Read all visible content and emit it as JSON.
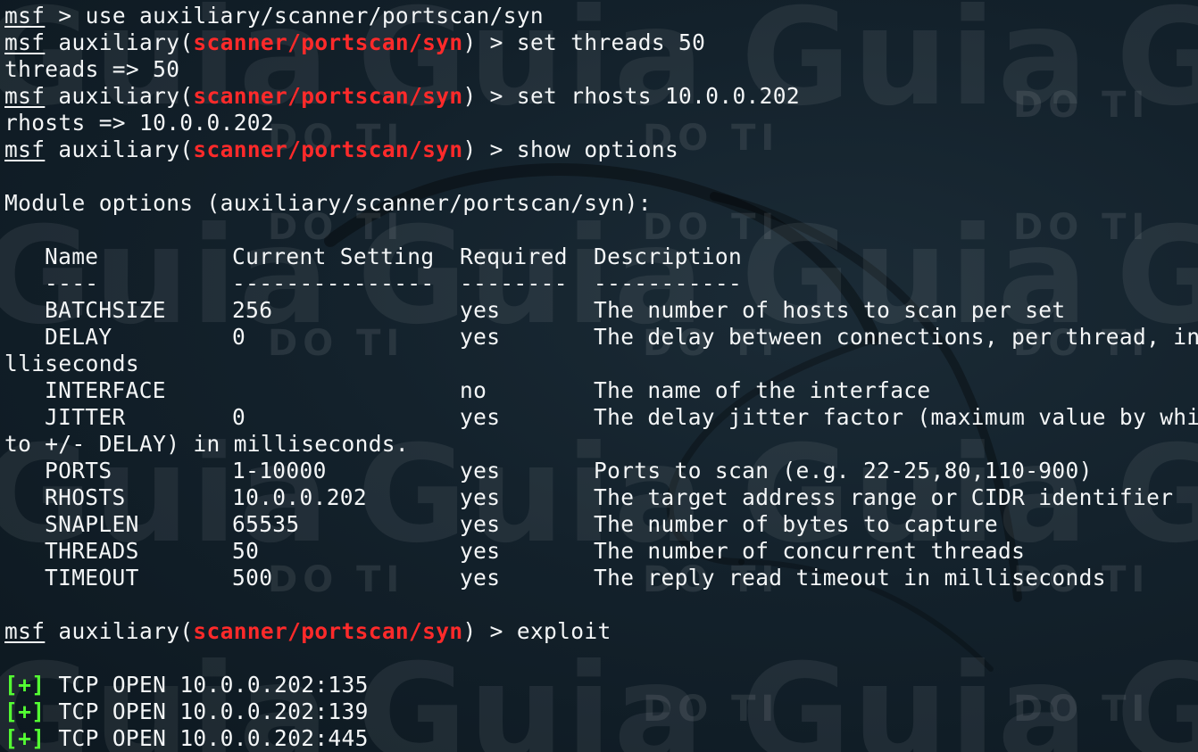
{
  "watermark": {
    "brand_word": "Guia",
    "brand_sub": "DO TI"
  },
  "prompt": {
    "base": "msf",
    "module_prefix": " auxiliary(",
    "module": "scanner/portscan/syn",
    "module_suffix": ") > "
  },
  "session": {
    "cmd_use": "msf > use auxiliary/scanner/portscan/syn",
    "cmd_set_threads": "set threads 50",
    "out_threads": "threads => 50",
    "cmd_set_rhosts": "set rhosts 10.0.0.202",
    "out_rhosts": "rhosts => 10.0.0.202",
    "cmd_show": "show options",
    "module_options_header": "Module options (auxiliary/scanner/portscan/syn):",
    "cmd_exploit": "exploit"
  },
  "options_table": {
    "headers": [
      "Name",
      "Current Setting",
      "Required",
      "Description"
    ],
    "separators": [
      "----",
      "---------------",
      "--------",
      "-----------"
    ],
    "rows": [
      {
        "name": "BATCHSIZE",
        "setting": "256",
        "required": "yes",
        "description": "The number of hosts to scan per set"
      },
      {
        "name": "DELAY",
        "setting": "0",
        "required": "yes",
        "description": "The delay between connections, per thread, in mi",
        "wrap": "lliseconds"
      },
      {
        "name": "INTERFACE",
        "setting": "",
        "required": "no",
        "description": "The name of the interface"
      },
      {
        "name": "JITTER",
        "setting": "0",
        "required": "yes",
        "description": "The delay jitter factor (maximum value by which",
        "wrap": "to +/- DELAY) in milliseconds."
      },
      {
        "name": "PORTS",
        "setting": "1-10000",
        "required": "yes",
        "description": "Ports to scan (e.g. 22-25,80,110-900)"
      },
      {
        "name": "RHOSTS",
        "setting": "10.0.0.202",
        "required": "yes",
        "description": "The target address range or CIDR identifier"
      },
      {
        "name": "SNAPLEN",
        "setting": "65535",
        "required": "yes",
        "description": "The number of bytes to capture"
      },
      {
        "name": "THREADS",
        "setting": "50",
        "required": "yes",
        "description": "The number of concurrent threads"
      },
      {
        "name": "TIMEOUT",
        "setting": "500",
        "required": "yes",
        "description": "The reply read timeout in milliseconds"
      }
    ]
  },
  "results": {
    "marker": "[+]",
    "items": [
      " TCP OPEN 10.0.0.202:135",
      " TCP OPEN 10.0.0.202:139",
      " TCP OPEN 10.0.0.202:445"
    ]
  },
  "colors": {
    "background": "#0e1a22",
    "text": "#f4f6f7",
    "module_red": "#ff2a2a",
    "success_green": "#54ff33"
  }
}
